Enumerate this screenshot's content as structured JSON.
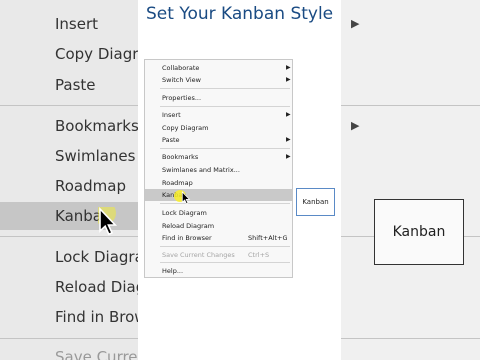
{
  "title": "Set Your Kanban Style",
  "menu": {
    "items": [
      {
        "label": "Collaborate",
        "submenu": true
      },
      {
        "label": "Switch View",
        "submenu": true
      },
      {
        "label": "Properties...",
        "submenu": false
      },
      {
        "label": "Insert",
        "submenu": true
      },
      {
        "label": "Copy Diagram",
        "submenu": false
      },
      {
        "label": "Paste",
        "submenu": true
      },
      {
        "label": "Bookmarks",
        "submenu": true
      },
      {
        "label": "Swimlanes and Matrix...",
        "submenu": false
      },
      {
        "label": "Roadmap",
        "submenu": false
      },
      {
        "label": "Kanban",
        "submenu": false,
        "highlighted": true
      },
      {
        "label": "Lock Diagram",
        "submenu": false
      },
      {
        "label": "Reload Diagram",
        "submenu": false
      },
      {
        "label": "Find in Browser",
        "shortcut": "Shift+Alt+G",
        "submenu": false
      },
      {
        "label": "Save Current Changes",
        "shortcut": "Ctrl+S",
        "disabled": true,
        "submenu": false
      },
      {
        "label": "Help...",
        "submenu": false
      }
    ]
  },
  "preview_label": "Kanban",
  "background_left": {
    "items": [
      "Insert",
      "Copy Diagra",
      "Paste",
      "Bookmarks",
      "Swimlanes a",
      "Roadmap",
      "Kanba",
      "Lock Diagra",
      "Reload Diagr",
      "Find in Brow",
      "Save Curren"
    ]
  },
  "background_right": {
    "kanban_box_label": "Kanban"
  },
  "colors": {
    "title": "#1a4b83",
    "highlight": "#c9c9c9",
    "cursor_highlight": "#faf028",
    "preview_border": "#5a8ac6"
  }
}
